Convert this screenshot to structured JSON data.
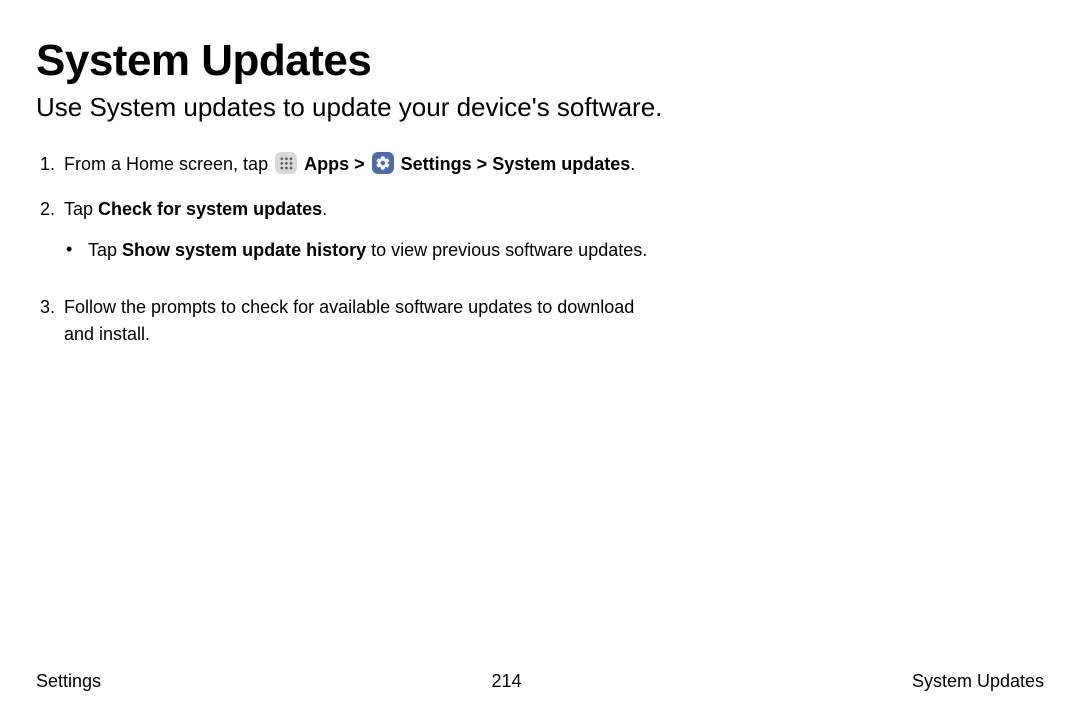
{
  "heading": "System Updates",
  "subtitle": "Use System updates to update your device's software.",
  "steps": {
    "s1": {
      "num": "1.",
      "pre": "From a Home screen, tap ",
      "apps": "Apps",
      "sep1": " > ",
      "settings": "Settings",
      "sep2": " > ",
      "sysupd": "System updates",
      "end": "."
    },
    "s2": {
      "num": "2.",
      "pre": "Tap ",
      "bold": "Check for system updates",
      "end": ".",
      "bullet": {
        "pre": "Tap ",
        "bold": "Show system update history",
        "post": " to view previous software updates."
      }
    },
    "s3": {
      "num": "3.",
      "text": "Follow the prompts to check for available software updates to download and install."
    }
  },
  "footer": {
    "left": "Settings",
    "center": "214",
    "right": "System Updates"
  }
}
